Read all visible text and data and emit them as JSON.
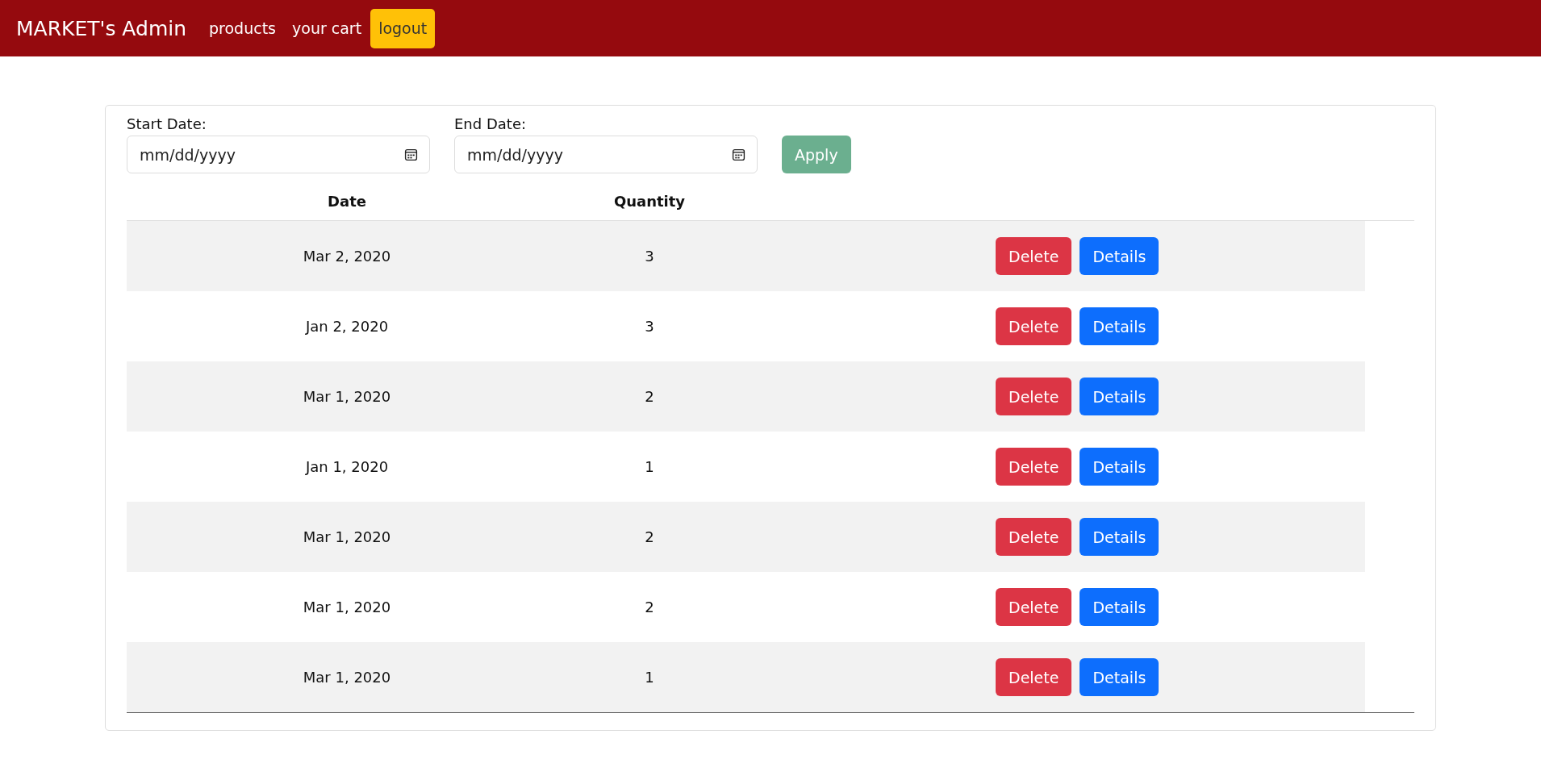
{
  "navbar": {
    "brand": "MARKET's Admin",
    "links": [
      {
        "label": "products",
        "kind": "link"
      },
      {
        "label": "your cart",
        "kind": "link"
      },
      {
        "label": "logout",
        "kind": "button"
      }
    ]
  },
  "filter": {
    "start": {
      "label": "Start Date:",
      "placeholder": "mm/dd/yyyy"
    },
    "end": {
      "label": "End Date:",
      "placeholder": "mm/dd/yyyy"
    },
    "apply": "Apply"
  },
  "table": {
    "columns": [
      "Date",
      "Quantity"
    ],
    "rows": [
      {
        "date": "Mar 2, 2020",
        "quantity": "3",
        "actions": [
          "Delete",
          "Details"
        ]
      },
      {
        "date": "Jan 2, 2020",
        "quantity": "3",
        "actions": [
          "Delete",
          "Details"
        ]
      },
      {
        "date": "Mar 1, 2020",
        "quantity": "2",
        "actions": [
          "Delete",
          "Details"
        ]
      },
      {
        "date": "Jan 1, 2020",
        "quantity": "1",
        "actions": [
          "Delete",
          "Details"
        ]
      },
      {
        "date": "Mar 1, 2020",
        "quantity": "2",
        "actions": [
          "Delete",
          "Details"
        ]
      },
      {
        "date": "Mar 1, 2020",
        "quantity": "2",
        "actions": [
          "Delete",
          "Details"
        ]
      },
      {
        "date": "Mar 1, 2020",
        "quantity": "1",
        "actions": [
          "Delete",
          "Details"
        ]
      }
    ]
  }
}
